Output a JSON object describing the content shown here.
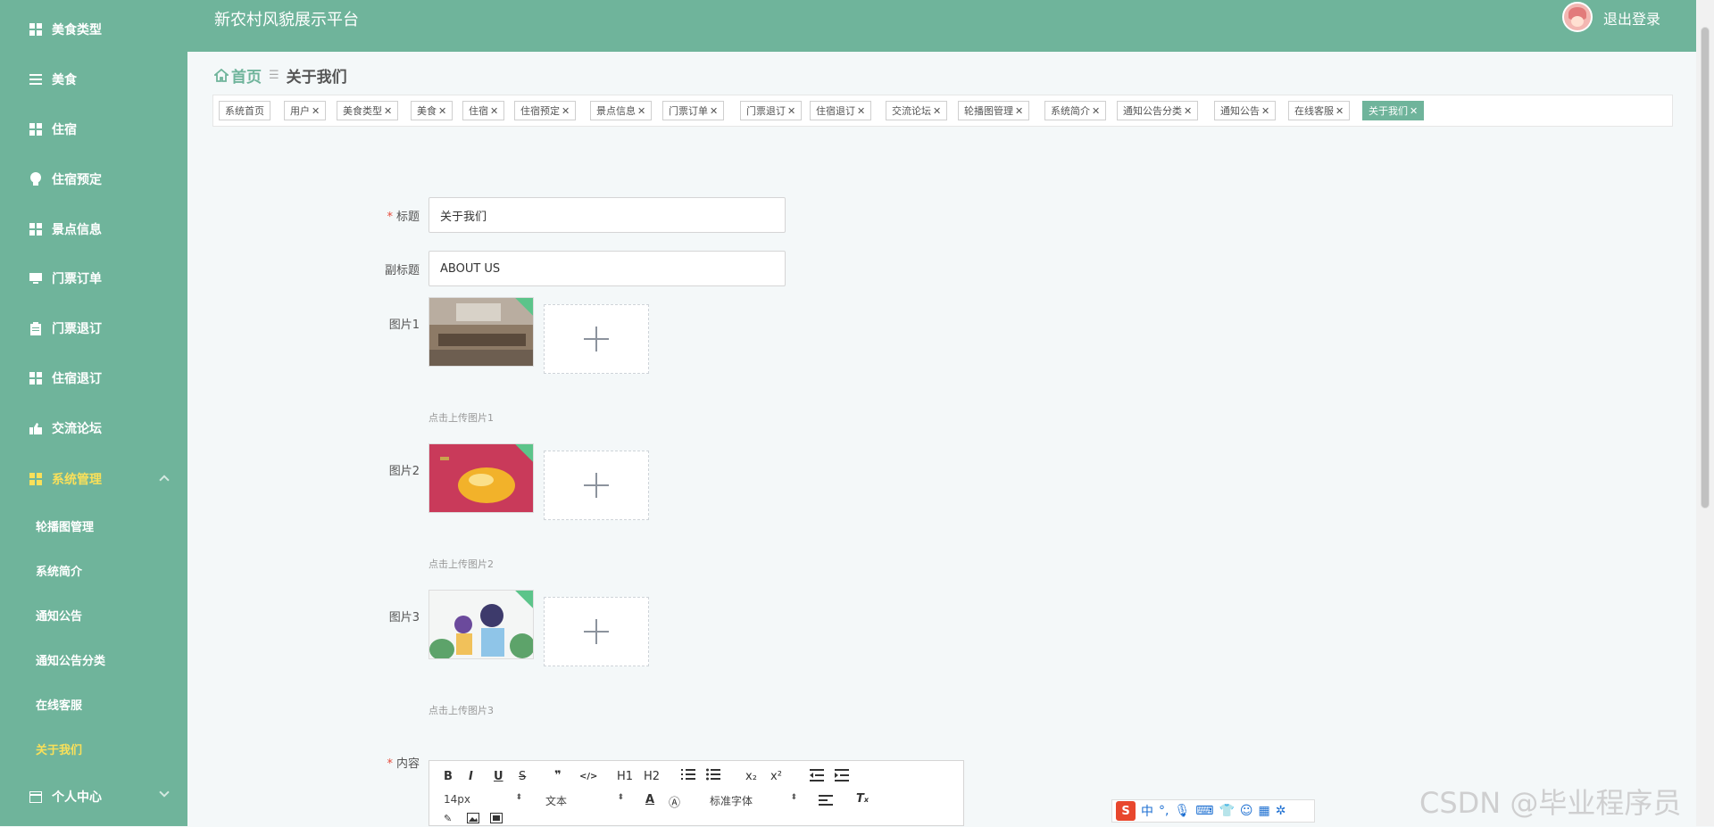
{
  "header": {
    "title": "新农村风貌展示平台",
    "logout": "退出登录"
  },
  "sidebar": {
    "items": [
      {
        "label": "美食类型",
        "icon": "grid-icon"
      },
      {
        "label": "美食",
        "icon": "list-icon"
      },
      {
        "label": "住宿",
        "icon": "grid-icon"
      },
      {
        "label": "住宿预定",
        "icon": "bulb-icon"
      },
      {
        "label": "景点信息",
        "icon": "grid-icon"
      },
      {
        "label": "门票订单",
        "icon": "monitor-icon"
      },
      {
        "label": "门票退订",
        "icon": "clipboard-icon"
      },
      {
        "label": "住宿退订",
        "icon": "grid-icon"
      },
      {
        "label": "交流论坛",
        "icon": "thumb-icon"
      },
      {
        "label": "系统管理",
        "icon": "grid-icon"
      }
    ],
    "sub_items": [
      "轮播图管理",
      "系统简介",
      "通知公告",
      "通知公告分类",
      "在线客服",
      "关于我们"
    ],
    "personal": "个人中心",
    "active_color": "#f9e05a"
  },
  "breadcrumb": {
    "home": "首页",
    "current": "关于我们"
  },
  "tags": [
    "系统首页",
    "用户",
    "美食类型",
    "美食",
    "住宿",
    "住宿预定",
    "景点信息",
    "门票订单",
    "门票退订",
    "住宿退订",
    "交流论坛",
    "轮播图管理",
    "系统简介",
    "通知公告分类",
    "通知公告",
    "在线客服",
    "关于我们"
  ],
  "form": {
    "title_label": "标题",
    "title_value": "关于我们",
    "subtitle_label": "副标题",
    "subtitle_value": "ABOUT US",
    "pic1_label": "图片1",
    "pic1_hint": "点击上传图片1",
    "pic2_label": "图片2",
    "pic2_hint": "点击上传图片2",
    "pic3_label": "图片3",
    "pic3_hint": "点击上传图片3",
    "content_label": "内容"
  },
  "editor": {
    "font_size": "14px",
    "text_type": "文本",
    "font_family": "标准字体",
    "buttons": [
      "B",
      "I",
      "U",
      "S",
      "❞",
      "</>",
      "H1",
      "H2",
      "ol",
      "ul",
      "x₂",
      "x²",
      "outdent",
      "indent"
    ]
  },
  "ime": {
    "lang": "中"
  },
  "watermark": "CSDN @毕业程序员",
  "colors": {
    "primary": "#6fb49b",
    "required": "#e74c3c"
  }
}
